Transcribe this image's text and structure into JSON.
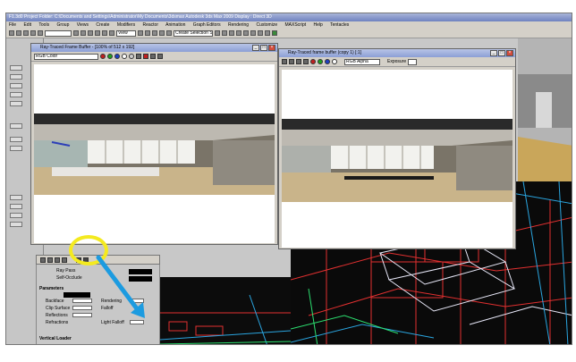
{
  "app": {
    "title": "F1.3d0     Project Folder: C:\\Documents and Settings\\Administrator\\My Documents\\3dsmax     Autodesk 3ds Max 2009     Display : Direct 3D",
    "menus": [
      "File",
      "Edit",
      "Tools",
      "Group",
      "Views",
      "Create",
      "Modifiers",
      "Reactor",
      "Animation",
      "Graph Editors",
      "Rendering",
      "Customize",
      "MAXScript",
      "Help",
      "Tentacles"
    ],
    "toolbar_dropdown": "View",
    "toolbar_dropdown2": "Create Selection Se"
  },
  "left_vfb": {
    "title": "Ray-Traced Frame Buffer - [100% of 512 x 192]",
    "channel_dropdown": "RGB Color",
    "swatch_colors": [
      "#c02020",
      "#20a020",
      "#1f3fc0",
      "#ffffff",
      "#cccccc"
    ]
  },
  "right_vfb": {
    "title": "Ray-Traced frame buffer (copy 1) [:1]",
    "channel_dropdown": "RGB Alpha",
    "zoom_label": "Exposure",
    "swatch_colors": [
      "#c02020",
      "#20a020",
      "#1f3fc0",
      "#ffffff"
    ]
  },
  "render_panel": {
    "sections": [
      "Parameters",
      "Vertical Loader"
    ],
    "labels": [
      "Ray Pass",
      "Self-Occlude",
      "Backface",
      "Rendering",
      "Clip Surface",
      "Falloff",
      "Reflections",
      "Refractions",
      "Light Falloff"
    ]
  },
  "callout": {
    "color": "#f4ea1f",
    "arrow_color": "#1c9be0"
  }
}
